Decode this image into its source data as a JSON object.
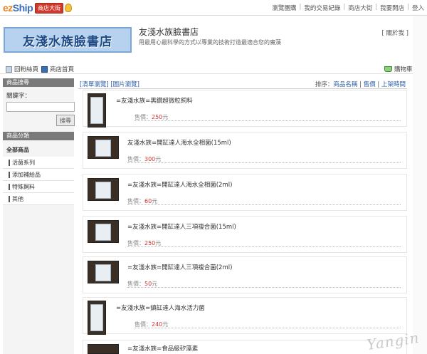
{
  "topbar": {
    "logo_text_ez": "ez",
    "logo_text_ship": "Ship",
    "logo_tag": "商店大街",
    "nav": [
      "瀏覽團購",
      "我的交易紀錄",
      "商店大街",
      "我要開店",
      "登入"
    ]
  },
  "header": {
    "banner_text": "友淺水族臉書店",
    "store_name": "友淺水族臉書店",
    "store_desc": "用最用心最科學的方式以專業的技術打造最適合您的魔藻",
    "about_link": "[ 關於我 ]"
  },
  "navstrip": {
    "back_label": "回粉絲頁",
    "home_label": "商店首頁",
    "cart_label": "購物車"
  },
  "sidebar": {
    "search_title": "商品搜尋",
    "keyword_label": "關鍵字：",
    "keyword_value": "",
    "search_button": "搜尋",
    "category_title": "商品分類",
    "all_label": "全部商品",
    "categories": [
      "活菌系列",
      "添加補給品",
      "特殊飼料",
      "其他"
    ]
  },
  "list": {
    "view_links": "[清單瀏覽] [圖片瀏覽]",
    "sort_label": "排序：",
    "sort_options": [
      "商品名稱",
      "售價",
      "上架時間"
    ],
    "price_prefix": "售價：",
    "price_suffix": "元",
    "products": [
      {
        "name": "=友淺水族=黑鑽超微粒飼料",
        "price": "250"
      },
      {
        "name": "友淺水族=開缸達人海水全相菌(15ml)",
        "price": "300"
      },
      {
        "name": "=友淺水族=開缸達人海水全相菌(2ml)",
        "price": "60"
      },
      {
        "name": "=友淺水族=開缸達人三項複合菌(15ml)",
        "price": "250"
      },
      {
        "name": "=友淺水族=開缸達人三項複合菌(2ml)",
        "price": "50"
      },
      {
        "name": "=友淺水族=鎮缸達人海水活力菌",
        "price": "240"
      },
      {
        "name": "=友淺水族=食品級矽藻素",
        "price": ""
      }
    ]
  },
  "watermark": "Yangin"
}
